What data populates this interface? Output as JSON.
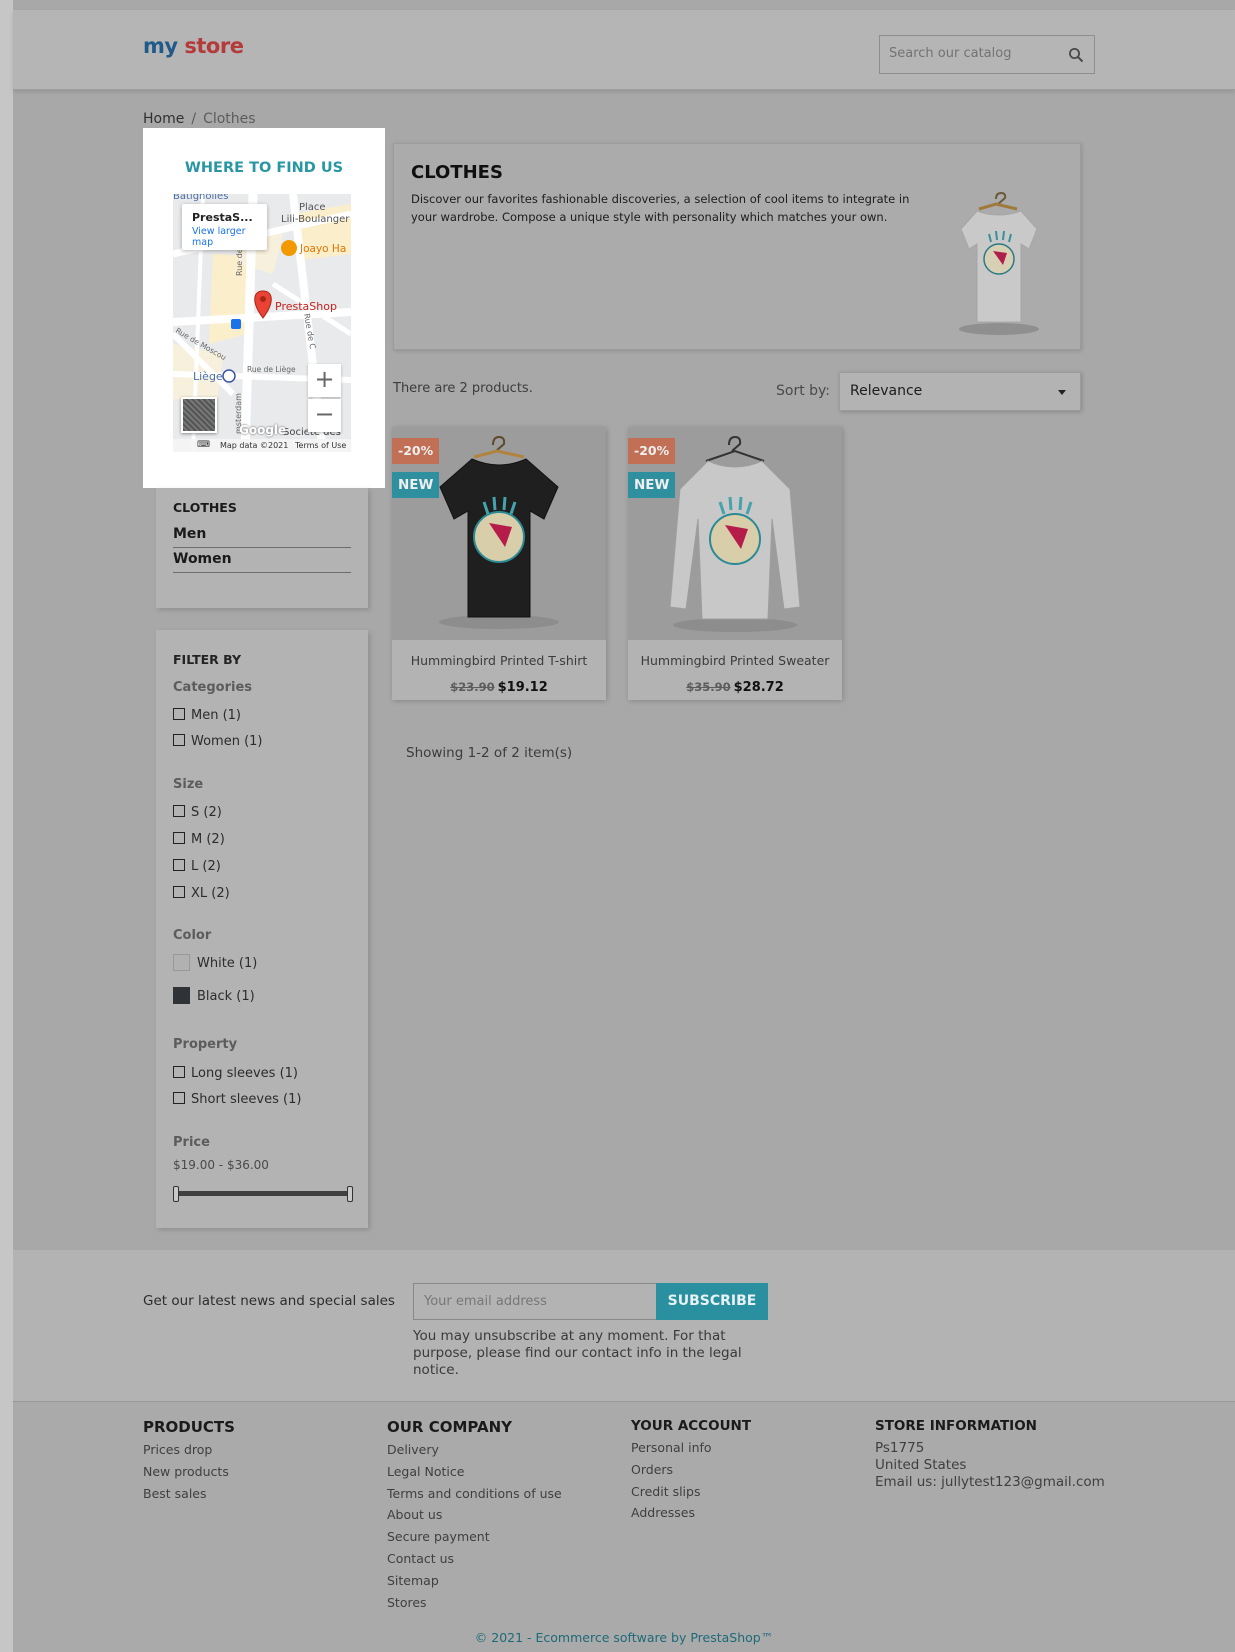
{
  "header": {
    "logo_part1": "my",
    "logo_part2": "store",
    "search_placeholder": "Search our catalog"
  },
  "breadcrumb": {
    "home": "Home",
    "separator": "/",
    "current": "Clothes"
  },
  "map_block": {
    "title": "WHERE TO FIND US",
    "popup_name": "PrestaS...",
    "popup_link": "View larger map",
    "marker_label": "PrestaShop",
    "street_labels": [
      "Batignolles",
      "Place",
      "Lili-Boulanger",
      "Joayo Ha",
      "Rue de",
      "Rue de Moscou",
      "Rue de Liège",
      "Liège",
      "Rue de C",
      "msterdam",
      "Societe des"
    ],
    "zoom_in": "+",
    "zoom_out": "−",
    "google": "Google",
    "map_data": "Map data ©2021",
    "terms": "Terms of Use"
  },
  "categories": {
    "title": "CLOTHES",
    "items": [
      "Men",
      "Women"
    ]
  },
  "filters": {
    "title": "FILTER BY",
    "categories_heading": "Categories",
    "categories": [
      "Men (1)",
      "Women (1)"
    ],
    "size_heading": "Size",
    "sizes": [
      "S (2)",
      "M (2)",
      "L (2)",
      "XL (2)"
    ],
    "color_heading": "Color",
    "colors": [
      {
        "label": "White (1)",
        "swatch": "#b1b1b1"
      },
      {
        "label": "Black (1)",
        "swatch": "#2f3338"
      }
    ],
    "property_heading": "Property",
    "properties": [
      "Long sleeves (1)",
      "Short sleeves (1)"
    ],
    "price_heading": "Price",
    "price_range": "$19.00 - $36.00"
  },
  "category_header": {
    "name": "CLOTHES",
    "description": "Discover our favorites fashionable discoveries, a selection of cool items to integrate in your wardrobe. Compose a unique style with personality which matches your own."
  },
  "listing": {
    "count_text": "There are 2 products.",
    "sort_label": "Sort by:",
    "sort_value": "Relevance",
    "showing": "Showing 1-2 of 2 item(s)"
  },
  "products": [
    {
      "name": "Hummingbird Printed T-shirt",
      "old_price": "$23.90",
      "price": "$19.12",
      "discount": "-20%",
      "flag": "NEW",
      "shirt_color": "#1f1f1f"
    },
    {
      "name": "Hummingbird Printed Sweater",
      "old_price": "$35.90",
      "price": "$28.72",
      "discount": "-20%",
      "flag": "NEW",
      "shirt_color": "#c8c8c8"
    }
  ],
  "newsletter": {
    "text": "Get our latest news and special sales",
    "placeholder": "Your email address",
    "button": "SUBSCRIBE",
    "note": "You may unsubscribe at any moment. For that purpose, please find our contact info in the legal notice."
  },
  "footer": {
    "products": {
      "title": "PRODUCTS",
      "links": [
        "Prices drop",
        "New products",
        "Best sales"
      ]
    },
    "company": {
      "title": "OUR COMPANY",
      "links": [
        "Delivery",
        "Legal Notice",
        "Terms and conditions of use",
        "About us",
        "Secure payment",
        "Contact us",
        "Sitemap",
        "Stores"
      ]
    },
    "account": {
      "title": "YOUR ACCOUNT",
      "links": [
        "Personal info",
        "Orders",
        "Credit slips",
        "Addresses"
      ]
    },
    "store": {
      "title": "STORE INFORMATION",
      "lines": [
        "Ps1775",
        "United States",
        "Email us: jullytest123@gmail.com"
      ]
    },
    "copyright": "© 2021 - Ecommerce software by PrestaShop™"
  },
  "colors": {
    "accent": "#2896a5",
    "discount_badge": "#c17055",
    "new_badge": "#2e8f9e"
  }
}
